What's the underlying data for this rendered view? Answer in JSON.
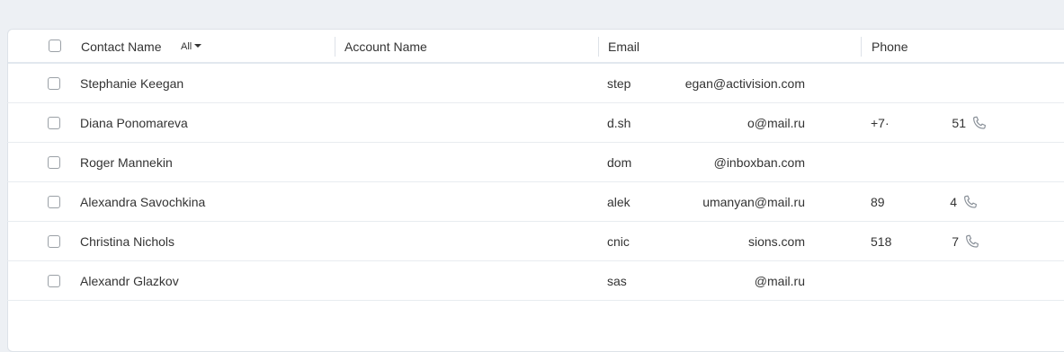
{
  "header": {
    "contact_name": "Contact Name",
    "filter_label": "All",
    "account_name": "Account Name",
    "email": "Email",
    "phone": "Phone"
  },
  "rows": [
    {
      "name": "Stephanie Keegan",
      "email_start": "step",
      "email_end": "egan@activision.com",
      "phone_start": "",
      "phone_end": "",
      "has_phone": false
    },
    {
      "name": "Diana Ponomareva",
      "email_start": "d.sh",
      "email_end": "o@mail.ru",
      "phone_start": "+7·",
      "phone_end": "51",
      "has_phone": true
    },
    {
      "name": "Roger Mannekin",
      "email_start": "dom",
      "email_end": "@inboxban.com",
      "phone_start": "",
      "phone_end": "",
      "has_phone": false
    },
    {
      "name": "Alexandra Savochkina",
      "email_start": "alek",
      "email_end": "umanyan@mail.ru",
      "phone_start": "89",
      "phone_end": "4",
      "has_phone": true
    },
    {
      "name": "Christina Nichols",
      "email_start": "cnic",
      "email_end": "sions.com",
      "phone_start": "518",
      "phone_end": "7",
      "has_phone": true
    },
    {
      "name": "Alexandr Glazkov",
      "email_start": "sas",
      "email_end": "@mail.ru",
      "phone_start": "",
      "phone_end": "",
      "has_phone": false
    }
  ],
  "icons": {
    "phone": "phone-icon",
    "checkbox": "checkbox-icon",
    "caret": "caret-down-icon"
  }
}
